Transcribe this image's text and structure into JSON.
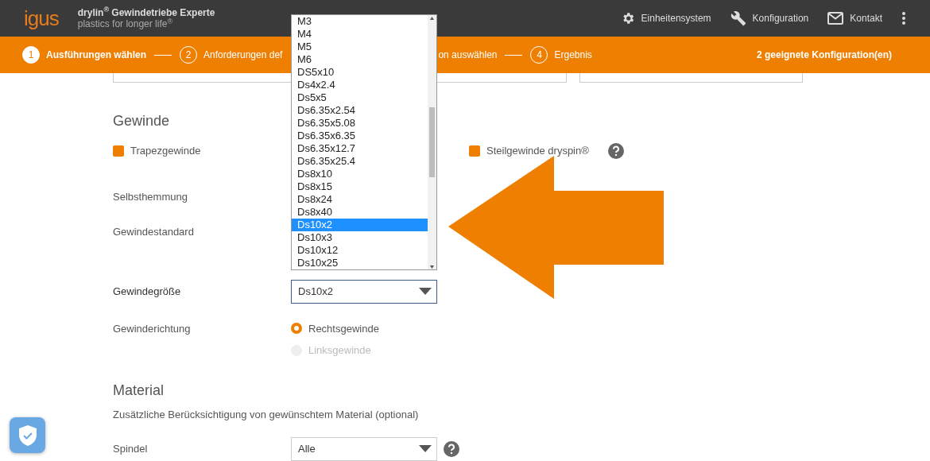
{
  "header": {
    "logo": "igus",
    "title": "drylin$^{®}$ Gewindetriebe Experte",
    "subtitle": "plastics for longer life$^{®}$",
    "actions": [
      {
        "kind": "gear",
        "label": "Einheitensystem"
      },
      {
        "kind": "wrench",
        "label": "Konfiguration"
      },
      {
        "kind": "mail",
        "label": "Kontakt"
      },
      {
        "kind": "more"
      }
    ]
  },
  "steps": [
    {
      "number": "1",
      "label": "Ausführungen wählen",
      "selected": true
    },
    {
      "number": "2",
      "label": "Anforderungen def",
      "selected": false
    },
    {
      "label": "on auswählen",
      "selected": false
    },
    {
      "number": "4",
      "label": "Ergebnis",
      "selected": false
    }
  ],
  "result_count": "2 geeignete Konfiguration(en)",
  "gewinde": {
    "heading": "Gewinde",
    "thread_types": [
      {
        "label": "Trapezgewinde",
        "checked": true,
        "help": false
      },
      {
        "label": "Steilgewinde dryspin®",
        "checked": true,
        "help": true
      }
    ],
    "rows": [
      {
        "label": "Selbsthemmung"
      },
      {
        "label": "Gewindestandard"
      }
    ],
    "size": {
      "label": "Gewindegröße",
      "value": "Ds10x2",
      "options": [
        {
          "label": "M3",
          "selected": false
        },
        {
          "label": "M4",
          "selected": false
        },
        {
          "label": "M5",
          "selected": false
        },
        {
          "label": "M6",
          "selected": false
        },
        {
          "label": "DS5x10",
          "selected": false
        },
        {
          "label": "Ds4x2.4",
          "selected": false
        },
        {
          "label": "Ds5x5",
          "selected": false
        },
        {
          "label": "Ds6.35x2.54",
          "selected": false
        },
        {
          "label": "Ds6.35x5.08",
          "selected": false
        },
        {
          "label": "Ds6.35x6.35",
          "selected": false
        },
        {
          "label": "Ds6.35x12.7",
          "selected": false
        },
        {
          "label": "Ds6.35x25.4",
          "selected": false
        },
        {
          "label": "Ds8x10",
          "selected": false
        },
        {
          "label": "Ds8x15",
          "selected": false
        },
        {
          "label": "Ds8x24",
          "selected": false
        },
        {
          "label": "Ds8x40",
          "selected": false
        },
        {
          "label": "Ds10x2",
          "selected": true
        },
        {
          "label": "Ds10x3",
          "selected": false
        },
        {
          "label": "Ds10x12",
          "selected": false
        },
        {
          "label": "Ds10x25",
          "selected": false
        }
      ]
    },
    "direction": {
      "label": "Gewinderichtung",
      "options": [
        {
          "label": "Rechtsgewinde",
          "selected": true,
          "disabled": false
        },
        {
          "label": "Linksgewinde",
          "selected": false,
          "disabled": true
        }
      ]
    }
  },
  "material": {
    "heading": "Material",
    "description": "Zusätzliche Berücksichtigung von gewünschtem Material (optional)",
    "rows": [
      {
        "label": "Spindel",
        "value": "Alle"
      }
    ]
  }
}
